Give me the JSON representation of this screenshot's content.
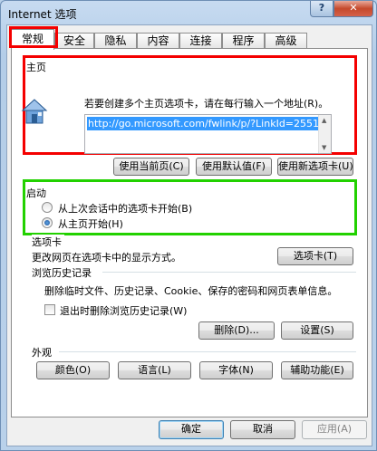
{
  "window": {
    "title": "Internet 选项",
    "help_label": "?",
    "close_label": "✕"
  },
  "tabs": [
    {
      "label": "常规",
      "active": true
    },
    {
      "label": "安全",
      "active": false
    },
    {
      "label": "隐私",
      "active": false
    },
    {
      "label": "内容",
      "active": false
    },
    {
      "label": "连接",
      "active": false
    },
    {
      "label": "程序",
      "active": false
    },
    {
      "label": "高级",
      "active": false
    }
  ],
  "homepage": {
    "section_label": "主页",
    "instruction": "若要创建多个主页选项卡，请在每行输入一个地址(R)。",
    "url_value": "http://go.microsoft.com/fwlink/p/?LinkId=2551",
    "use_current_label": "使用当前页(C)",
    "use_default_label": "使用默认值(F)",
    "use_new_tab_label": "使用新选项卡(U)"
  },
  "startup": {
    "section_label": "启动",
    "option_last_session": "从上次会话中的选项卡开始(B)",
    "option_homepage": "从主页开始(H)",
    "selected": "homepage"
  },
  "tabs_section": {
    "section_label": "选项卡",
    "description": "更改网页在选项卡中的显示方式。",
    "button_label": "选项卡(T)"
  },
  "history": {
    "section_label": "浏览历史记录",
    "description": "删除临时文件、历史记录、Cookie、保存的密码和网页表单信息。",
    "delete_on_exit_label": "退出时删除浏览历史记录(W)",
    "delete_on_exit_checked": false,
    "delete_button_label": "删除(D)...",
    "settings_button_label": "设置(S)"
  },
  "appearance": {
    "section_label": "外观",
    "colors_label": "颜色(O)",
    "languages_label": "语言(L)",
    "fonts_label": "字体(N)",
    "accessibility_label": "辅助功能(E)"
  },
  "footer": {
    "ok_label": "确定",
    "cancel_label": "取消",
    "apply_label": "应用(A)"
  },
  "colors": {
    "highlight_red": "#f40000",
    "highlight_green": "#22d100",
    "selection_blue": "#3399ff"
  }
}
